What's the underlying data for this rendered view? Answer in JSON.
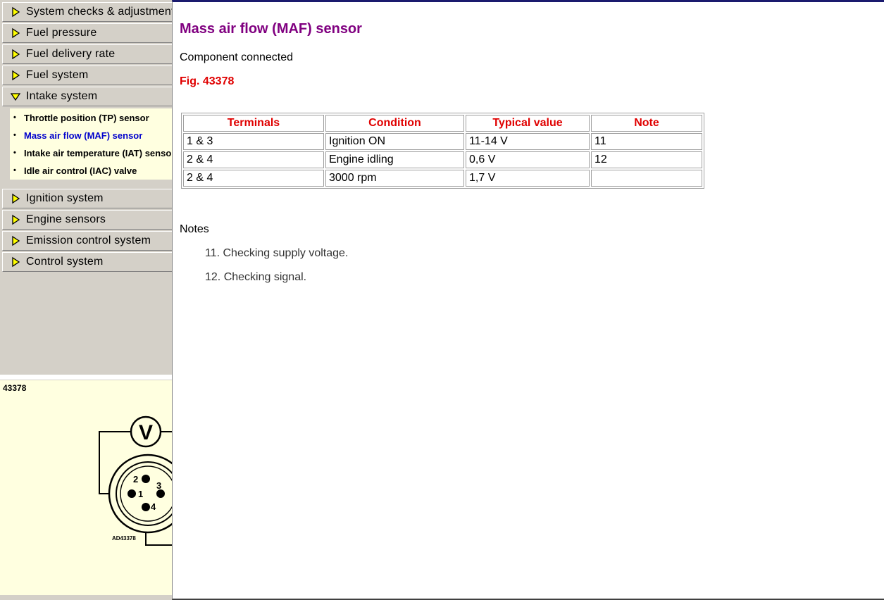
{
  "sidebar": {
    "items": [
      {
        "label": "System checks & adjustments"
      },
      {
        "label": "Fuel pressure"
      },
      {
        "label": "Fuel delivery rate"
      },
      {
        "label": "Fuel system"
      },
      {
        "label": "Intake system",
        "expanded": true
      },
      {
        "label": "Ignition system"
      },
      {
        "label": "Engine sensors"
      },
      {
        "label": "Emission control system"
      },
      {
        "label": "Control system"
      }
    ],
    "sub_items": [
      {
        "label": "Throttle position (TP) sensor"
      },
      {
        "label": "Mass air flow (MAF) sensor",
        "active": true
      },
      {
        "label": "Intake air temperature (IAT) sensor"
      },
      {
        "label": "Idle air control (IAC) valve"
      }
    ],
    "arrow_icon": "yellow-diamond-arrow-icon",
    "active_color": "#0000cc"
  },
  "figure": {
    "id": "43378",
    "meter_label": "V",
    "pins": [
      "1",
      "2",
      "3",
      "4"
    ],
    "code": "AD43378"
  },
  "content": {
    "title": "Mass air flow (MAF) sensor",
    "status": "Component connected",
    "fig_ref": "Fig. 43378",
    "table": {
      "headers": [
        "Terminals",
        "Condition",
        "Typical value",
        "Note"
      ],
      "rows": [
        [
          "1 & 3",
          "Ignition ON",
          "11-14 V",
          "11"
        ],
        [
          "2 & 4",
          "Engine idling",
          "0,6 V",
          "12"
        ],
        [
          "2 & 4",
          "3000 rpm",
          "1,7 V",
          ""
        ]
      ]
    },
    "notes_heading": "Notes",
    "notes": [
      "11. Checking supply voltage.",
      "12. Checking signal."
    ]
  },
  "colors": {
    "title": "#800080",
    "accent_red": "#e00000",
    "panel_gray": "#d4d0c8",
    "panel_yellow": "#ffffe0"
  }
}
